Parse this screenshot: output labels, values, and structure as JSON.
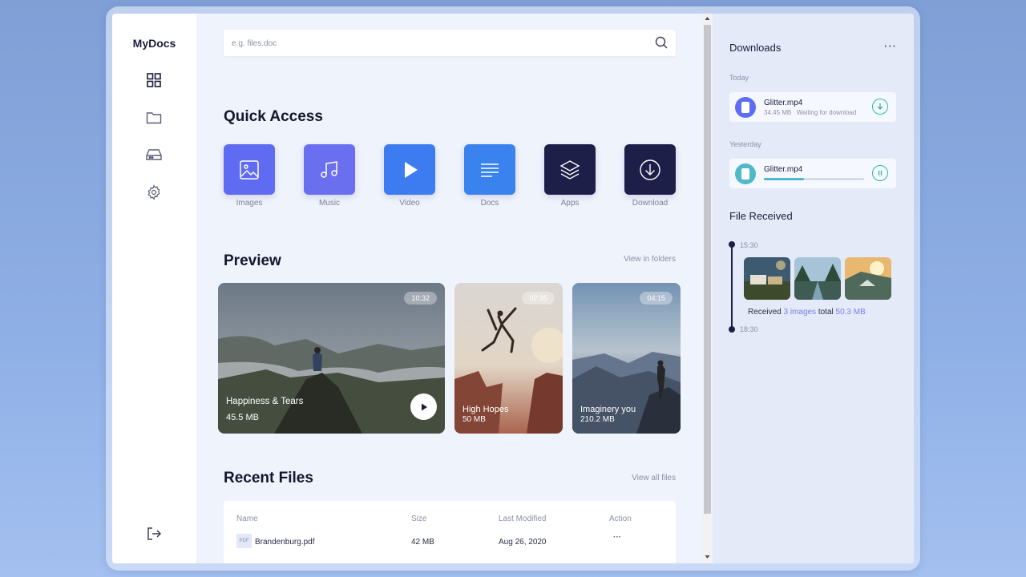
{
  "app": {
    "brand": "MyDocs"
  },
  "search": {
    "placeholder": "e.g. files.doc"
  },
  "quick_access": {
    "title": "Quick Access",
    "items": [
      {
        "label": "Images",
        "icon": "image-icon",
        "color": "#5f6cf1"
      },
      {
        "label": "Music",
        "icon": "music-icon",
        "color": "#6a6ff0"
      },
      {
        "label": "Video",
        "icon": "play-icon",
        "color": "#3d7cf0"
      },
      {
        "label": "Docs",
        "icon": "document-icon",
        "color": "#3a82ee"
      },
      {
        "label": "Apps",
        "icon": "layers-icon",
        "color": "#1e1f48"
      },
      {
        "label": "Download",
        "icon": "download-icon",
        "color": "#1e1f48"
      }
    ]
  },
  "preview": {
    "title": "Preview",
    "link": "View in folders",
    "cards": [
      {
        "title": "Happiness & Tears",
        "size": "45.5 MB",
        "duration": "10:32"
      },
      {
        "title": "High Hopes",
        "size": "50 MB",
        "duration": "02:35"
      },
      {
        "title": "Imaginery you",
        "size": "210.2 MB",
        "duration": "04:15"
      }
    ]
  },
  "recent": {
    "title": "Recent Files",
    "link": "View all files",
    "columns": [
      "Name",
      "Size",
      "Last Modified",
      "Action"
    ],
    "rows": [
      {
        "type": "PDF",
        "name": "Brandenburg.pdf",
        "size": "42 MB",
        "modified": "Aug 26, 2020",
        "action": "···"
      }
    ]
  },
  "downloads": {
    "title": "Downloads",
    "more": "···",
    "groups": [
      {
        "label": "Today",
        "item": {
          "name": "Glitter.mp4",
          "size": "34.45 MB",
          "status": "Waiting for download"
        }
      },
      {
        "label": "Yesterday",
        "item": {
          "name": "Glitter.mp4",
          "progress": 0.4
        }
      }
    ]
  },
  "received": {
    "title": "File Received",
    "time_start": "15:30",
    "time_end": "18:30",
    "summary_prefix": "Received",
    "count_text": "3 images",
    "summary_mid": "total",
    "total": "50.3 MB"
  },
  "colors": {
    "accent": "#5f6cf1",
    "success": "#2fbf8f",
    "progress": "#4fb9c9",
    "dark": "#1e1f48"
  }
}
